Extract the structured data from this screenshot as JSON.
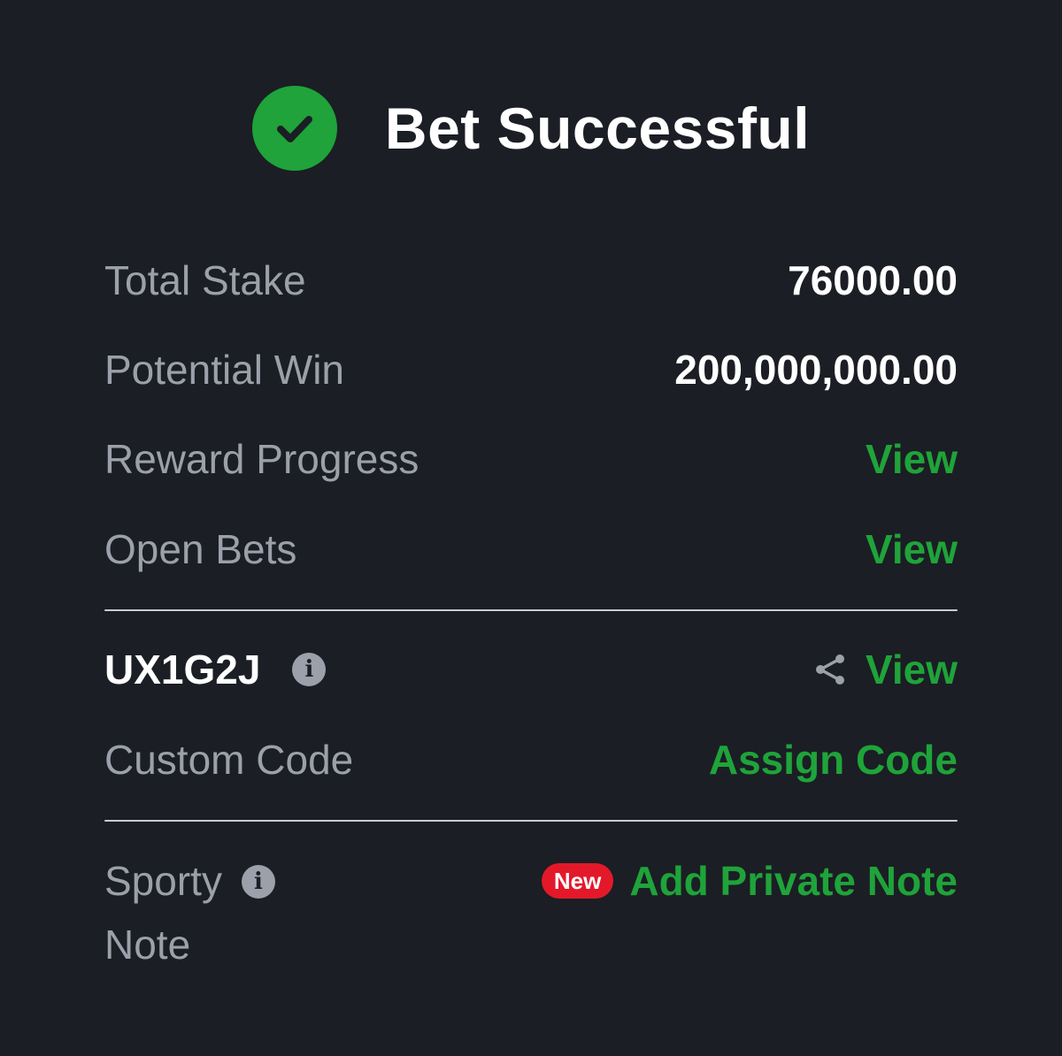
{
  "header": {
    "title": "Bet Successful",
    "icon": "check-circle-icon",
    "accent": "#1fa33a"
  },
  "summary": {
    "total_stake_label": "Total Stake",
    "total_stake_value": "76000.00",
    "potential_win_label": "Potential Win",
    "potential_win_value": "200,000,000.00",
    "reward_progress_label": "Reward Progress",
    "reward_progress_link": "View",
    "open_bets_label": "Open Bets",
    "open_bets_link": "View"
  },
  "booking": {
    "code": "UX1G2J",
    "info_icon": "info-icon",
    "share_icon": "share-icon",
    "view_link": "View",
    "custom_code_label": "Custom Code",
    "assign_code_link": "Assign Code"
  },
  "note": {
    "label_line1": "Sporty",
    "label_line2": "Note",
    "info_icon": "info-icon",
    "badge": "New",
    "badge_color": "#e3192a",
    "add_note_link": "Add Private Note"
  }
}
